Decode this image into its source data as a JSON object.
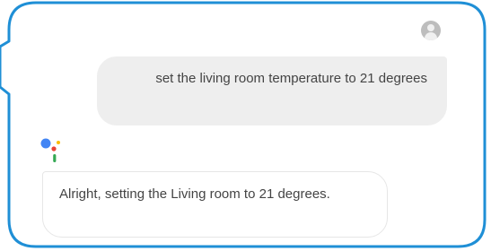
{
  "conversation": {
    "user_message": "set the living room temperature to 21 degrees",
    "assistant_reply": "Alright, setting the Living room to 21 degrees."
  },
  "icons": {
    "user_avatar": "user-avatar-icon",
    "assistant_logo": "google-assistant-icon"
  },
  "colors": {
    "frame": "#1f8fd6",
    "user_bubble": "#eeeeee",
    "assistant_bubble": "#ffffff",
    "text": "#444444",
    "logo_blue": "#4285f4",
    "logo_red": "#ea4335",
    "logo_yellow": "#fbbc05",
    "logo_green": "#34a853"
  }
}
